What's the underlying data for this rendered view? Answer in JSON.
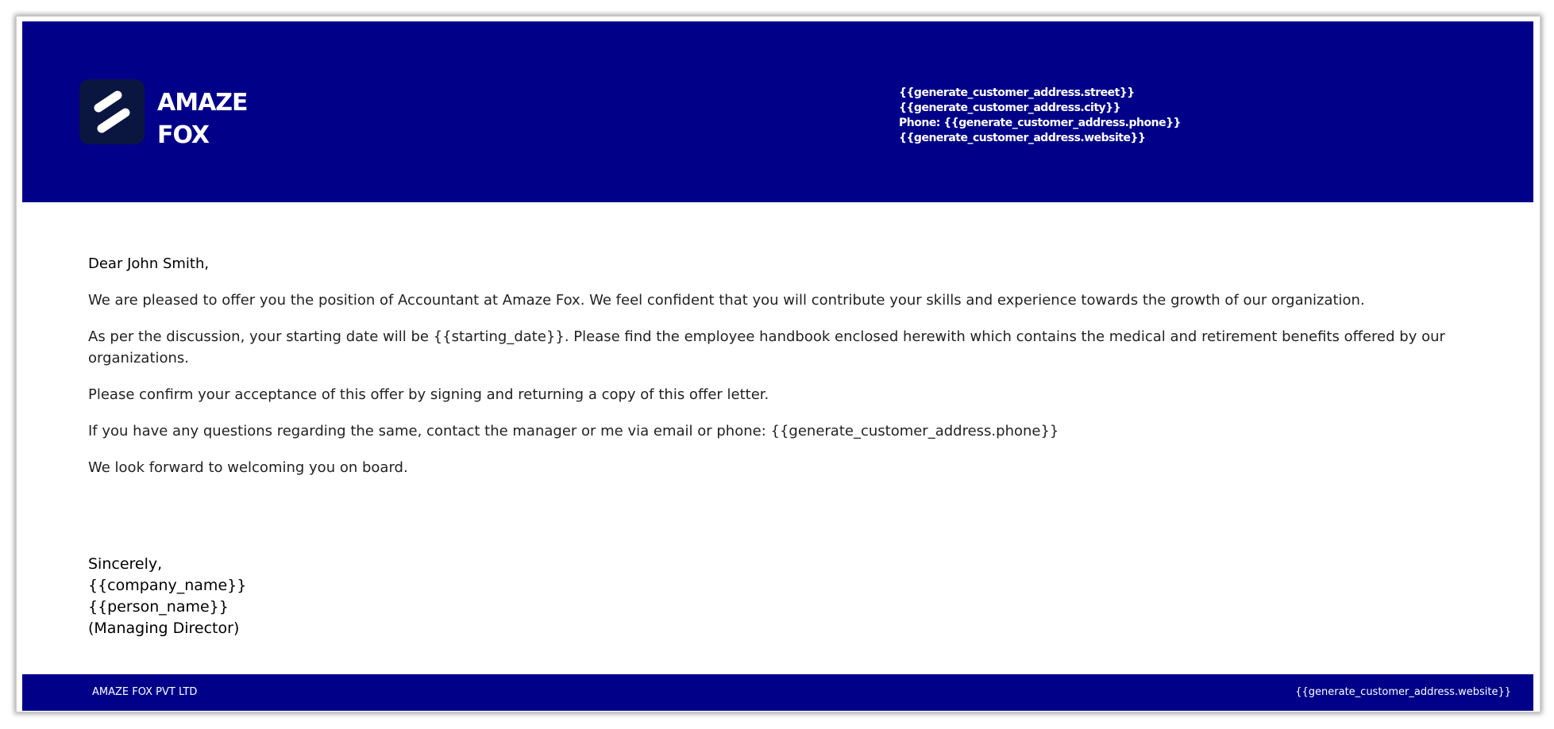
{
  "header": {
    "brand_line1": "AMAZE",
    "brand_line2": "FOX",
    "address_street": "{{generate_customer_address.street}}",
    "address_city": "{{generate_customer_address.city}}",
    "address_phone": "Phone: {{generate_customer_address.phone}}",
    "address_website": "{{generate_customer_address.website}}"
  },
  "letter": {
    "salutation": "Dear John Smith,",
    "paragraphs": [
      "We are pleased to offer you the position of Accountant at Amaze Fox. We feel confident that you will contribute your skills and experience towards the growth of our organization.",
      "As per the discussion, your starting date will be {{starting_date}}. Please find the employee handbook enclosed herewith which contains the medical and retirement benefits offered by our organizations.",
      "Please confirm your acceptance of this offer by signing and returning a copy of this offer letter.",
      "If you have any questions regarding the same, contact the manager or me via email or phone: {{generate_customer_address.phone}}",
      "We look forward to welcoming you on board."
    ],
    "closing": "Sincerely,",
    "company": "{{company_name}}",
    "person": "{{person_name}}",
    "role": "(Managing Director)"
  },
  "footer": {
    "company": "AMAZE FOX PVT LTD",
    "website": "{{generate_customer_address.website}}"
  },
  "colors": {
    "header_bg": "#000088",
    "footer_bg": "#000088",
    "logo_bg": "#0b1640"
  }
}
